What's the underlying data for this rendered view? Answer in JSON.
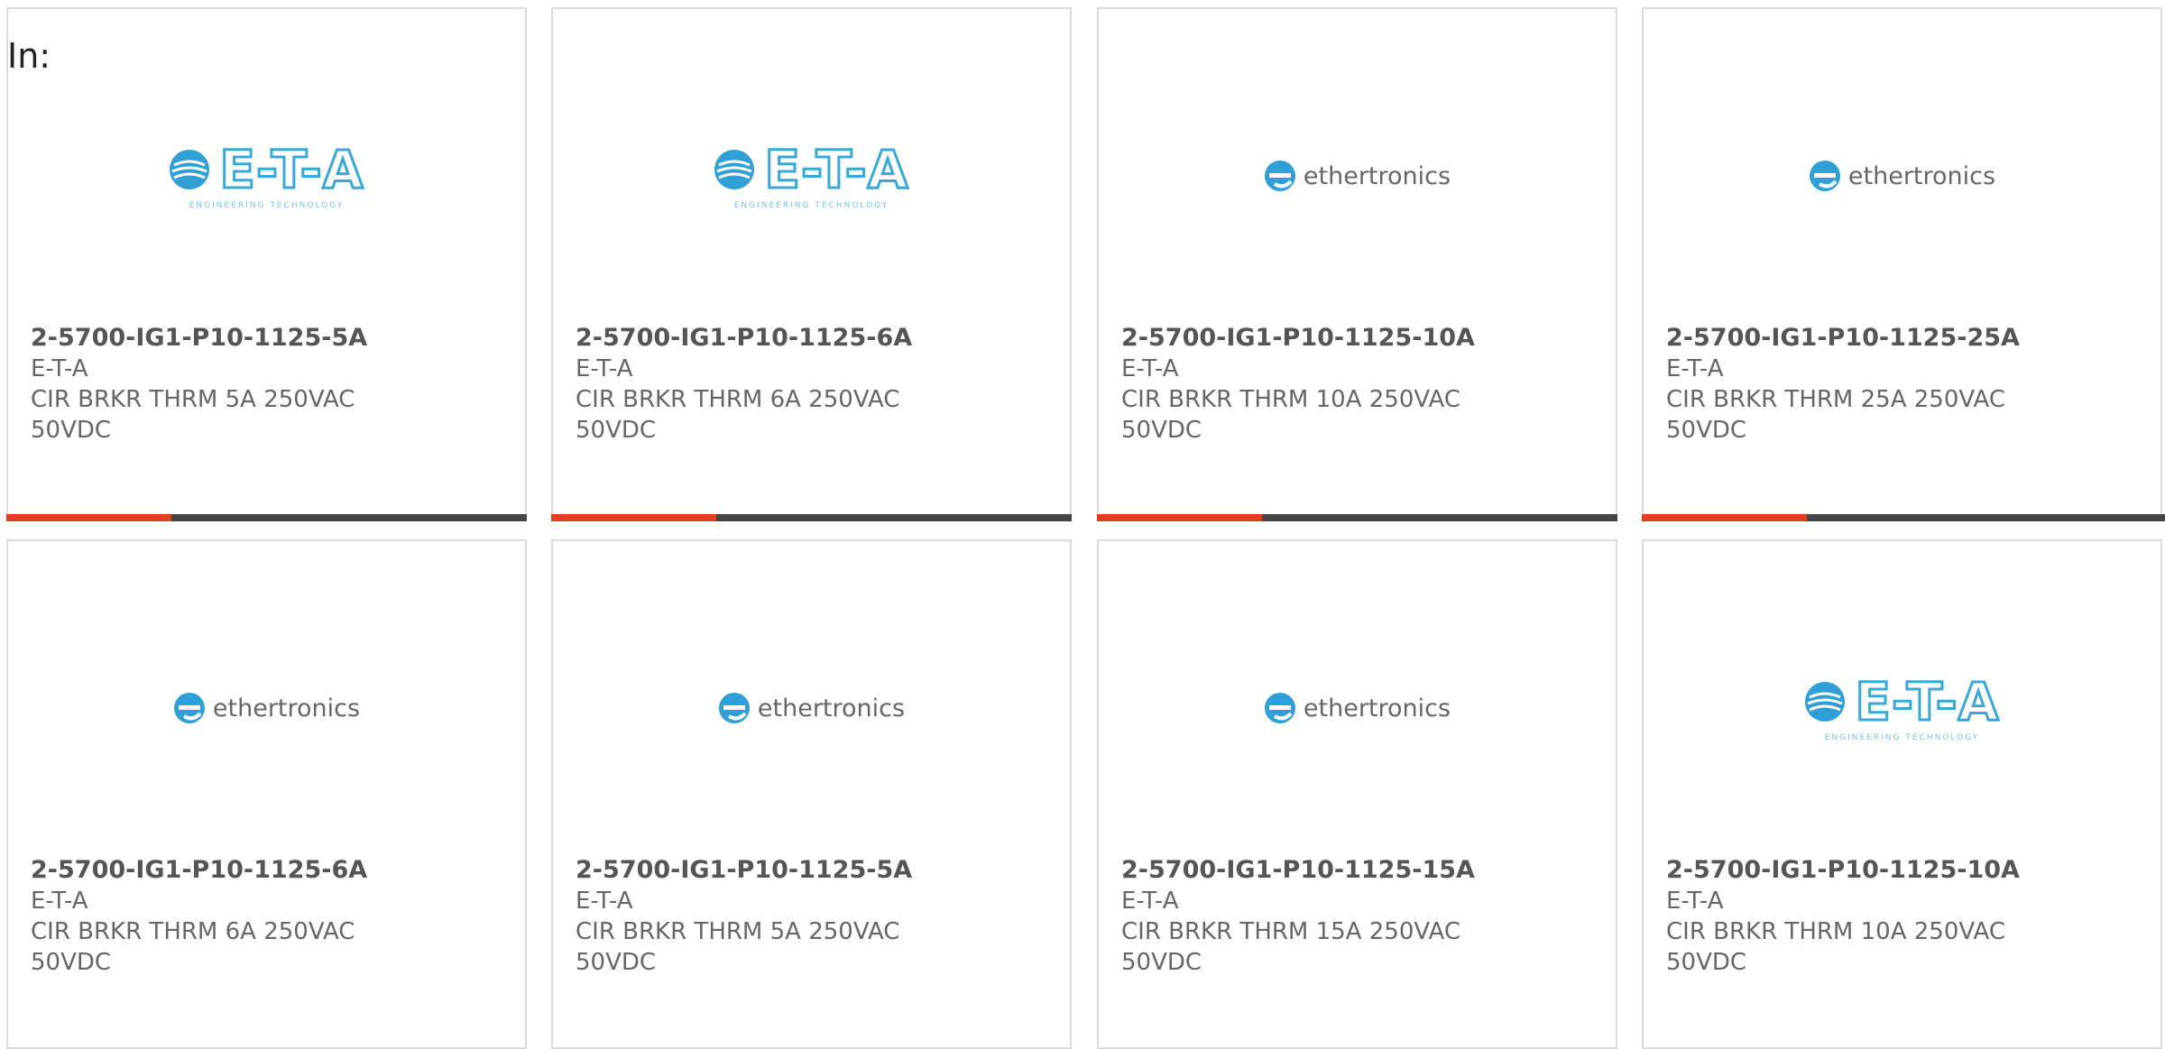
{
  "header": {
    "in_label": "In:"
  },
  "colors": {
    "accent_bar": "#e0411a",
    "bar_base": "#444444",
    "eta_blue": "#3aa7d9"
  },
  "cards": [
    {
      "part_number": "2-5700-IG1-P10-1125-5A",
      "manufacturer": "E-T-A",
      "description_line1": "CIR BRKR THRM 5A 250VAC",
      "description_line2": "50VDC",
      "logo": {
        "type": "eta",
        "letters": "E-T-A",
        "tagline": "ENGINEERING TECHNOLOGY"
      }
    },
    {
      "part_number": "2-5700-IG1-P10-1125-6A",
      "manufacturer": "E-T-A",
      "description_line1": "CIR BRKR THRM 6A 250VAC",
      "description_line2": "50VDC",
      "logo": {
        "type": "eta",
        "letters": "E-T-A",
        "tagline": "ENGINEERING TECHNOLOGY"
      }
    },
    {
      "part_number": "2-5700-IG1-P10-1125-10A",
      "manufacturer": "E-T-A",
      "description_line1": "CIR BRKR THRM 10A 250VAC",
      "description_line2": "50VDC",
      "logo": {
        "type": "ethertronics",
        "text": "ethertronics"
      }
    },
    {
      "part_number": "2-5700-IG1-P10-1125-25A",
      "manufacturer": "E-T-A",
      "description_line1": "CIR BRKR THRM 25A 250VAC",
      "description_line2": "50VDC",
      "logo": {
        "type": "ethertronics",
        "text": "ethertronics"
      }
    },
    {
      "part_number": "2-5700-IG1-P10-1125-6A",
      "manufacturer": "E-T-A",
      "description_line1": "CIR BRKR THRM 6A 250VAC",
      "description_line2": "50VDC",
      "logo": {
        "type": "ethertronics",
        "text": "ethertronics"
      }
    },
    {
      "part_number": "2-5700-IG1-P10-1125-5A",
      "manufacturer": "E-T-A",
      "description_line1": "CIR BRKR THRM 5A 250VAC",
      "description_line2": "50VDC",
      "logo": {
        "type": "ethertronics",
        "text": "ethertronics"
      }
    },
    {
      "part_number": "2-5700-IG1-P10-1125-15A",
      "manufacturer": "E-T-A",
      "description_line1": "CIR BRKR THRM 15A 250VAC",
      "description_line2": "50VDC",
      "logo": {
        "type": "ethertronics",
        "text": "ethertronics"
      }
    },
    {
      "part_number": "2-5700-IG1-P10-1125-10A",
      "manufacturer": "E-T-A",
      "description_line1": "CIR BRKR THRM 10A 250VAC",
      "description_line2": "50VDC",
      "logo": {
        "type": "eta",
        "letters": "E-T-A",
        "tagline": "ENGINEERING TECHNOLOGY"
      }
    }
  ]
}
